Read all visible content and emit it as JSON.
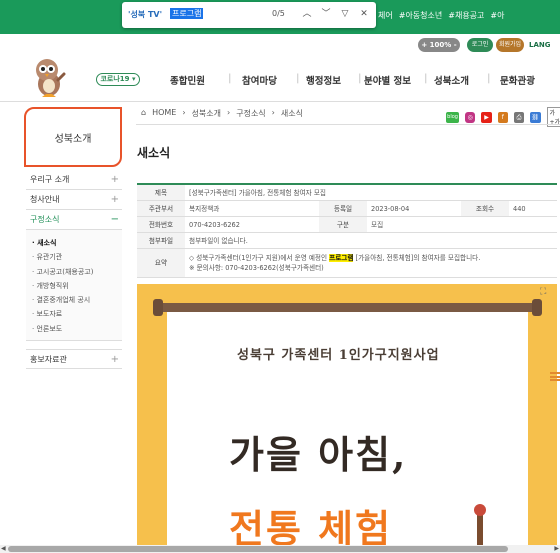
{
  "findbar": {
    "tab_label": "'성북 TV'",
    "query": "프로그램",
    "count": "0/5"
  },
  "top_links": [
    "체어",
    "#아동청소년",
    "#채용공고",
    "#아"
  ],
  "utility": {
    "zoom": "+ 100% -",
    "login": "로그인",
    "join": "회원가입",
    "lang": "LANG"
  },
  "header": {
    "corona": "코로나19 ▾",
    "gnb": [
      "종합민원",
      "참여마당",
      "행정정보",
      "분야별 정보",
      "성북소개",
      "문화관광"
    ]
  },
  "sidebar": {
    "title": "성북소개",
    "items": [
      {
        "label": "우리구 소개",
        "pm": "+"
      },
      {
        "label": "청사안내",
        "pm": "+"
      },
      {
        "label": "구정소식",
        "pm": "−"
      }
    ],
    "sub_items": [
      "새소식",
      "유관기관",
      "고시공고(채용공고)",
      "개방형직위",
      "결혼중개업체 공시",
      "보도자료",
      "언론보도"
    ],
    "last_item": {
      "label": "홍보자료관",
      "pm": "+"
    }
  },
  "breadcrumb": [
    "HOME",
    "성북소개",
    "구정소식",
    "새소식"
  ],
  "share": {
    "blog": "blog",
    "print": "",
    "scale": "가+가"
  },
  "page_title": "새소식",
  "board": {
    "title_label": "제목",
    "title": "[성북구가족센터] 가을아침, 전통체험 참여자 모집",
    "dept_label": "주관부서",
    "dept": "복지정책과",
    "date_label": "등록일",
    "date": "2023-08-04",
    "views_label": "조회수",
    "views": "440",
    "phone_label": "전화번호",
    "phone": "070-4203-6262",
    "type_label": "구분",
    "type": "모집",
    "attach_label": "첨부파일",
    "attach": "첨부파일이 없습니다.",
    "summary_label": "요약",
    "summary_pre": "◇ 성북구가족센터(1인가구 지원)에서 운영 예정인 ",
    "summary_hl": "프로그램",
    "summary_post": " [가을아침, 전통체험]의 참여자를 모집합니다.",
    "summary_line2": "※ 문의사항: 070-4203-6262(성북구가족센터)"
  },
  "poster": {
    "subtitle": "성북구 가족센터 1인가구지원사업",
    "main": "가을 아침,",
    "orange": "전통 체험"
  },
  "colors": {
    "green": "#1a9a5a",
    "orange": "#e8532a",
    "poster_bg": "#f6c04c"
  }
}
